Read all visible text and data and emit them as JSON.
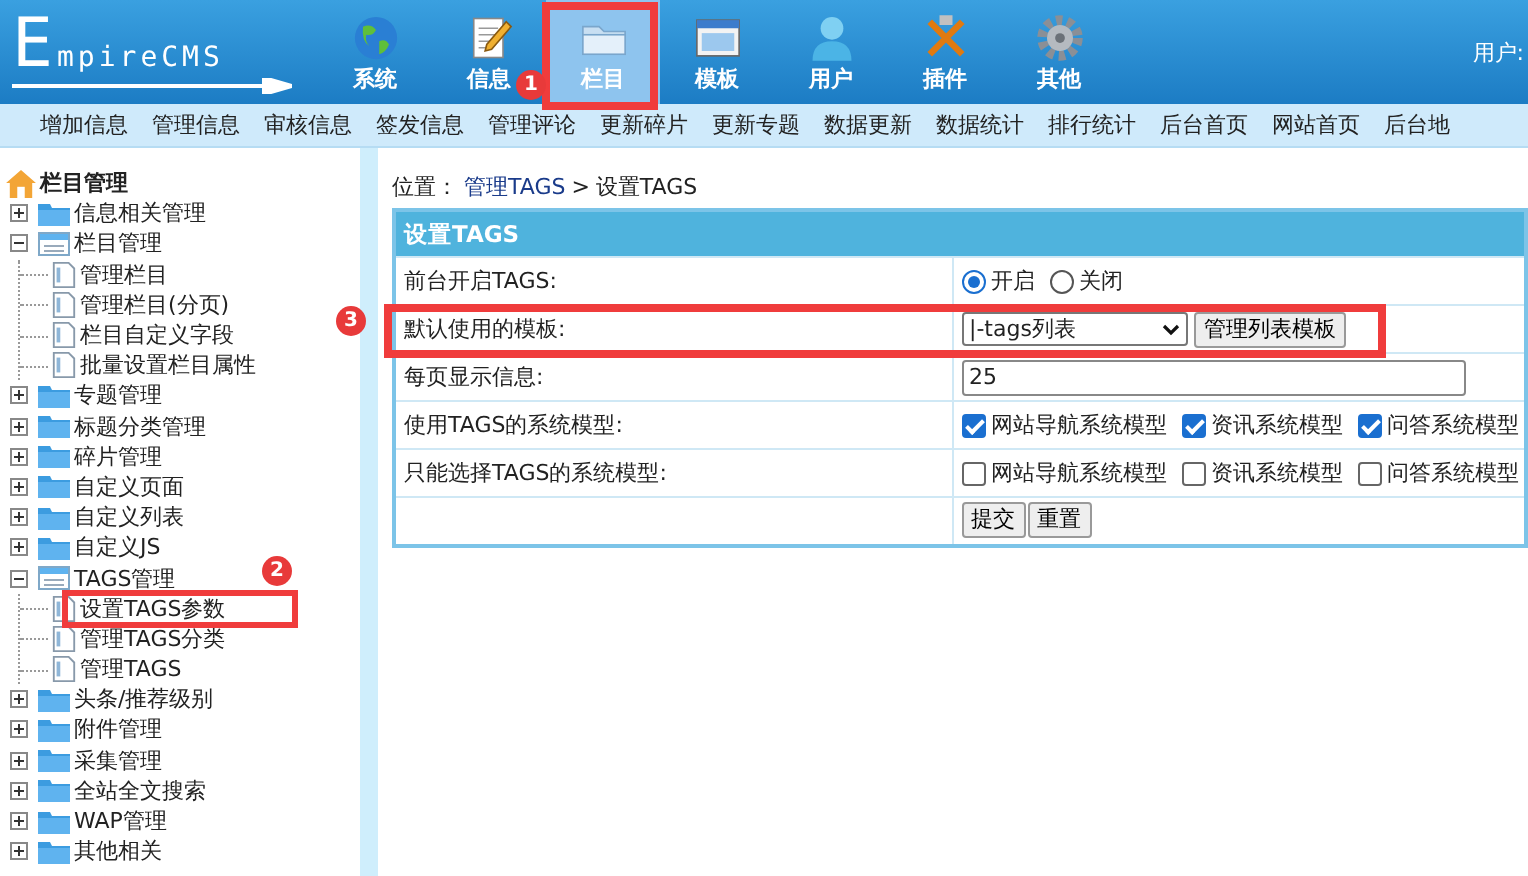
{
  "header": {
    "logo": "EmpireCMS",
    "nav": [
      {
        "label": "系统",
        "selected": false
      },
      {
        "label": "信息",
        "selected": false
      },
      {
        "label": "栏目",
        "selected": true
      },
      {
        "label": "模板",
        "selected": false
      },
      {
        "label": "用户",
        "selected": false
      },
      {
        "label": "插件",
        "selected": false
      },
      {
        "label": "其他",
        "selected": false
      }
    ],
    "user_label": "用户:"
  },
  "menu": [
    "增加信息",
    "管理信息",
    "审核信息",
    "签发信息",
    "管理评论",
    "更新碎片",
    "更新专题",
    "数据更新",
    "数据统计",
    "排行统计",
    "后台首页",
    "网站首页",
    "后台地"
  ],
  "sidebar": {
    "title": "栏目管理",
    "items": [
      {
        "label": "信息相关管理",
        "expanded": false
      },
      {
        "label": "栏目管理",
        "expanded": true,
        "children": [
          {
            "label": "管理栏目"
          },
          {
            "label": "管理栏目(分页)"
          },
          {
            "label": "栏目自定义字段"
          },
          {
            "label": "批量设置栏目属性"
          }
        ]
      },
      {
        "label": "专题管理",
        "expanded": false
      },
      {
        "label": "标题分类管理",
        "expanded": false
      },
      {
        "label": "碎片管理",
        "expanded": false
      },
      {
        "label": "自定义页面",
        "expanded": false
      },
      {
        "label": "自定义列表",
        "expanded": false
      },
      {
        "label": "自定义JS",
        "expanded": false
      },
      {
        "label": "TAGS管理",
        "expanded": true,
        "children": [
          {
            "label": "设置TAGS参数"
          },
          {
            "label": "管理TAGS分类"
          },
          {
            "label": "管理TAGS"
          }
        ]
      },
      {
        "label": "头条/推荐级别",
        "expanded": false
      },
      {
        "label": "附件管理",
        "expanded": false
      },
      {
        "label": "采集管理",
        "expanded": false
      },
      {
        "label": "全站全文搜索",
        "expanded": false
      },
      {
        "label": "WAP管理",
        "expanded": false
      },
      {
        "label": "其他相关",
        "expanded": false
      }
    ]
  },
  "breadcrumb": {
    "prefix": "位置：",
    "link": "管理TAGS",
    "separator": ">",
    "current": "设置TAGS"
  },
  "panel": {
    "title": "设置TAGS",
    "rows": [
      {
        "kind": "radio",
        "label": "前台开启TAGS:",
        "options": [
          {
            "label": "开启",
            "selected": true
          },
          {
            "label": "关闭",
            "selected": false
          }
        ]
      },
      {
        "kind": "select",
        "label": "默认使用的模板:",
        "value": "|-tags列表",
        "button": "管理列表模板"
      },
      {
        "kind": "text",
        "label": "每页显示信息:",
        "value": "25"
      },
      {
        "kind": "checkboxes",
        "label": "使用TAGS的系统模型:",
        "options": [
          {
            "label": "网站导航系统模型",
            "checked": true
          },
          {
            "label": "资讯系统模型",
            "checked": true
          },
          {
            "label": "问答系统模型",
            "checked": true
          }
        ]
      },
      {
        "kind": "checkboxes",
        "label": "只能选择TAGS的系统模型:",
        "options": [
          {
            "label": "网站导航系统模型",
            "checked": false
          },
          {
            "label": "资讯系统模型",
            "checked": false
          },
          {
            "label": "问答系统模型",
            "checked": false
          }
        ]
      },
      {
        "kind": "buttons",
        "buttons": [
          "提交",
          "重置"
        ]
      }
    ]
  },
  "annotations": [
    {
      "label": "1"
    },
    {
      "label": "2"
    },
    {
      "label": "3"
    }
  ]
}
